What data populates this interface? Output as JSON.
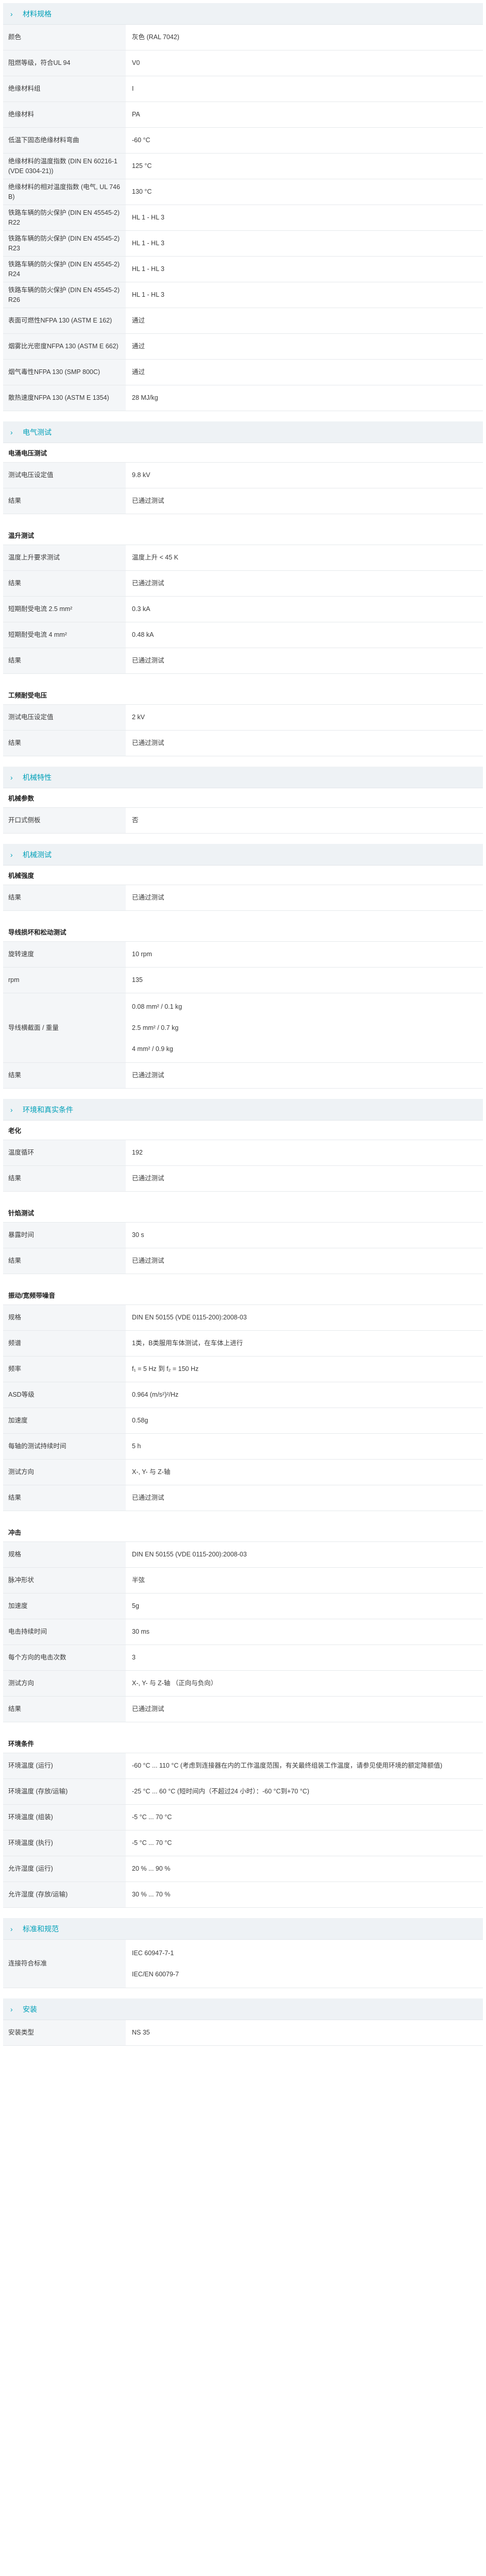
{
  "colors": {
    "accent": "#00a0b8",
    "label_bg": "#f4f6f8",
    "header_bg": "#eef2f5"
  },
  "sections": [
    {
      "icon": "chevron-right-icon",
      "title": "材料规格",
      "rows": [
        {
          "type": "kv",
          "label": "颜色",
          "value": "灰色 (RAL 7042)"
        },
        {
          "type": "kv",
          "label": "阻燃等级，符合UL 94",
          "value": "V0"
        },
        {
          "type": "kv",
          "label": "绝缘材料组",
          "value": "I"
        },
        {
          "type": "kv",
          "label": "绝缘材料",
          "value": "PA"
        },
        {
          "type": "kv",
          "label": "低温下固态绝缘材料弯曲",
          "value": "-60 °C"
        },
        {
          "type": "kv",
          "label": "绝缘材料的温度指数 (DIN EN 60216-1 (VDE 0304-21))",
          "value": "125 °C"
        },
        {
          "type": "kv",
          "label": "绝缘材料的相对温度指数 (电气, UL 746 B)",
          "value": "130 °C"
        },
        {
          "type": "kv",
          "label": "铁路车辆的防火保护 (DIN EN 45545-2) R22",
          "value": "HL 1 - HL 3"
        },
        {
          "type": "kv",
          "label": "铁路车辆的防火保护 (DIN EN 45545-2) R23",
          "value": "HL 1 - HL 3"
        },
        {
          "type": "kv",
          "label": "铁路车辆的防火保护 (DIN EN 45545-2) R24",
          "value": "HL 1 - HL 3"
        },
        {
          "type": "kv",
          "label": "铁路车辆的防火保护 (DIN EN 45545-2) R26",
          "value": "HL 1 - HL 3"
        },
        {
          "type": "kv",
          "label": "表面可燃性NFPA 130 (ASTM E 162)",
          "value": "通过"
        },
        {
          "type": "kv",
          "label": "烟雾比光密度NFPA 130 (ASTM E 662)",
          "value": "通过"
        },
        {
          "type": "kv",
          "label": "烟气毒性NFPA 130 (SMP 800C)",
          "value": "通过"
        },
        {
          "type": "kv",
          "label": "散热速度NFPA 130 (ASTM E 1354)",
          "value": "28 MJ/kg"
        }
      ]
    },
    {
      "icon": "chevron-right-icon",
      "title": "电气测试",
      "rows": [
        {
          "type": "sub",
          "label": "电涌电压测试"
        },
        {
          "type": "kv",
          "label": "测试电压设定值",
          "value": "9.8 kV"
        },
        {
          "type": "kv",
          "label": "结果",
          "value": "已通过测试"
        },
        {
          "type": "spacer"
        },
        {
          "type": "sub",
          "label": "温升测试"
        },
        {
          "type": "kv",
          "label": "温度上升要求测试",
          "value": "温度上升 < 45 K"
        },
        {
          "type": "kv",
          "label": "结果",
          "value": "已通过测试"
        },
        {
          "type": "kv",
          "label": "短期耐受电流 2.5 mm²",
          "value": "0.3 kA"
        },
        {
          "type": "kv",
          "label": "短期耐受电流 4 mm²",
          "value": "0.48 kA"
        },
        {
          "type": "kv",
          "label": "结果",
          "value": "已通过测试"
        },
        {
          "type": "spacer"
        },
        {
          "type": "sub",
          "label": "工频耐受电压"
        },
        {
          "type": "kv",
          "label": "测试电压设定值",
          "value": "2 kV"
        },
        {
          "type": "kv",
          "label": "结果",
          "value": "已通过测试"
        }
      ]
    },
    {
      "icon": "chevron-right-icon",
      "title": "机械特性",
      "rows": [
        {
          "type": "sub",
          "label": "机械参数"
        },
        {
          "type": "kv",
          "label": "开口式侧板",
          "value": "否"
        }
      ]
    },
    {
      "icon": "chevron-right-icon",
      "title": "机械测试",
      "rows": [
        {
          "type": "sub",
          "label": "机械强度"
        },
        {
          "type": "kv",
          "label": "结果",
          "value": "已通过测试"
        },
        {
          "type": "spacer"
        },
        {
          "type": "sub",
          "label": "导线损坏和松动测试"
        },
        {
          "type": "kv",
          "label": "旋转速度",
          "value": "10 rpm"
        },
        {
          "type": "kv",
          "label": "rpm",
          "value": "135"
        },
        {
          "type": "multi",
          "label": "导线横截面 / 重量",
          "values": [
            "0.08 mm² / 0.1 kg",
            "2.5 mm² / 0.7 kg",
            "4 mm² / 0.9 kg"
          ]
        },
        {
          "type": "kv",
          "label": "结果",
          "value": "已通过测试"
        }
      ]
    },
    {
      "icon": "chevron-right-icon",
      "title": "环境和真实条件",
      "rows": [
        {
          "type": "sub",
          "label": "老化"
        },
        {
          "type": "kv",
          "label": "温度循环",
          "value": "192"
        },
        {
          "type": "kv",
          "label": "结果",
          "value": "已通过测试"
        },
        {
          "type": "spacer"
        },
        {
          "type": "sub",
          "label": "针焰测试"
        },
        {
          "type": "kv",
          "label": "暴露时间",
          "value": "30 s"
        },
        {
          "type": "kv",
          "label": "结果",
          "value": "已通过测试"
        },
        {
          "type": "spacer"
        },
        {
          "type": "sub",
          "label": "振动/宽频带噪音"
        },
        {
          "type": "kv",
          "label": "规格",
          "value": "DIN EN 50155 (VDE 0115-200):2008-03"
        },
        {
          "type": "kv",
          "label": "频谱",
          "value": "1类，B类服用车体测试，在车体上进行"
        },
        {
          "type": "kv",
          "label": "频率",
          "value": "f₁ = 5 Hz 到 f₂ = 150 Hz"
        },
        {
          "type": "kv",
          "label": "ASD等级",
          "value": "0.964 (m/s²)²/Hz"
        },
        {
          "type": "kv",
          "label": "加速度",
          "value": "0.58g"
        },
        {
          "type": "kv",
          "label": "每轴的测试持续时间",
          "value": "5 h"
        },
        {
          "type": "kv",
          "label": "测试方向",
          "value": "X-, Y- 与 Z-轴"
        },
        {
          "type": "kv",
          "label": "结果",
          "value": "已通过测试"
        },
        {
          "type": "spacer"
        },
        {
          "type": "sub",
          "label": "冲击"
        },
        {
          "type": "kv",
          "label": "规格",
          "value": "DIN EN 50155 (VDE 0115-200):2008-03"
        },
        {
          "type": "kv",
          "label": "脉冲形状",
          "value": "半弦"
        },
        {
          "type": "kv",
          "label": "加速度",
          "value": "5g"
        },
        {
          "type": "kv",
          "label": "电击持续时间",
          "value": "30 ms"
        },
        {
          "type": "kv",
          "label": "每个方向的电击次数",
          "value": "3"
        },
        {
          "type": "kv",
          "label": "测试方向",
          "value": "X-, Y- 与 Z-轴 （正向与负向）"
        },
        {
          "type": "kv",
          "label": "结果",
          "value": "已通过测试"
        },
        {
          "type": "spacer"
        },
        {
          "type": "sub",
          "label": "环境条件"
        },
        {
          "type": "kv",
          "label": "环境温度 (运行)",
          "value": "-60 °C ... 110 °C (考虑到连接器在内的工作温度范围，有关最终组装工作温度，请参见使用环境的额定降额值)"
        },
        {
          "type": "kv",
          "label": "环境温度 (存放/运输)",
          "value": "-25 °C ... 60 °C (短时间内（不超过24 小时）：-60 °C到+70 °C)"
        },
        {
          "type": "kv",
          "label": "环境温度 (组装)",
          "value": "-5 °C ... 70 °C"
        },
        {
          "type": "kv",
          "label": "环境温度 (执行)",
          "value": "-5 °C ... 70 °C"
        },
        {
          "type": "kv",
          "label": "允许湿度 (运行)",
          "value": "20 % ... 90 %"
        },
        {
          "type": "kv",
          "label": "允许湿度 (存放/运输)",
          "value": "30 % ... 70 %"
        }
      ]
    },
    {
      "icon": "chevron-right-icon",
      "title": "标准和规范",
      "rows": [
        {
          "type": "multi",
          "label": "连接符合标准",
          "values": [
            "IEC 60947-7-1",
            "IEC/EN 60079-7"
          ]
        }
      ]
    },
    {
      "icon": "chevron-right-icon",
      "title": "安装",
      "rows": [
        {
          "type": "kv",
          "label": "安装类型",
          "value": "NS 35"
        }
      ]
    }
  ]
}
